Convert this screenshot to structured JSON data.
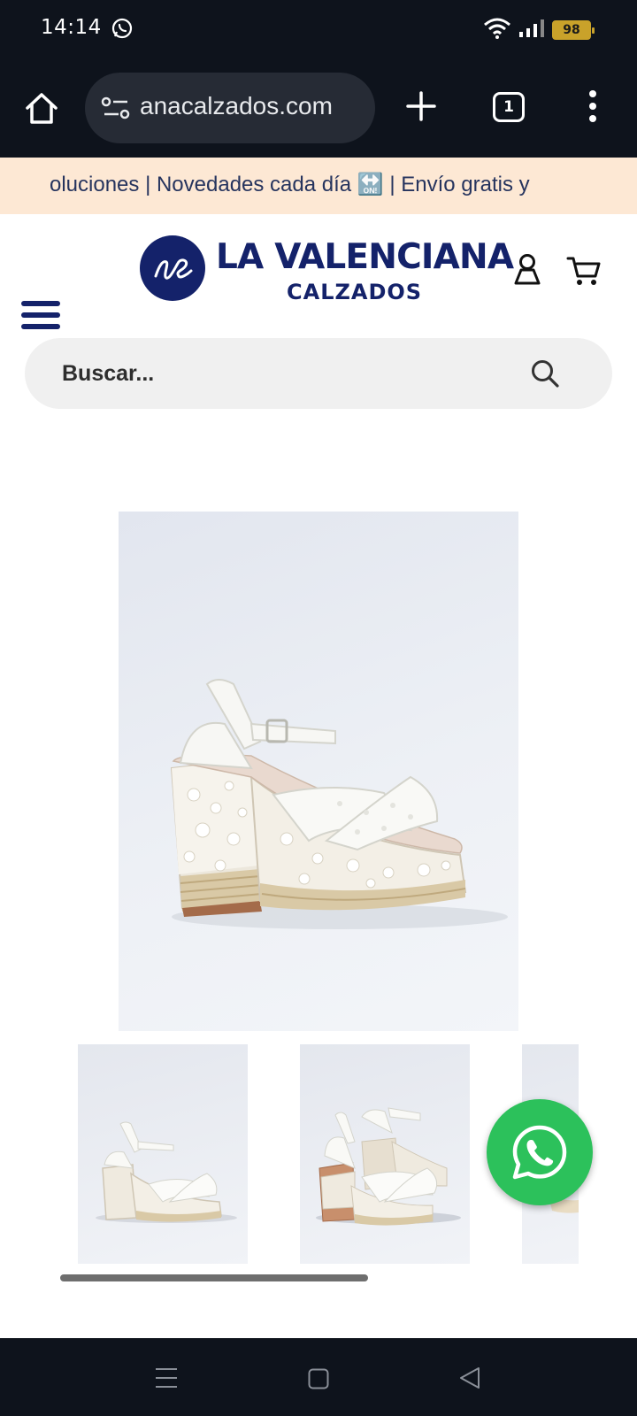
{
  "status_bar": {
    "time": "14:14",
    "battery": "98",
    "icons": [
      "whatsapp-icon",
      "wifi-icon",
      "signal-icon",
      "battery-icon"
    ]
  },
  "browser": {
    "url": "anacalzados.com",
    "tab_count": "1",
    "icons": [
      "home-icon",
      "site-settings-icon",
      "plus-icon",
      "tab-switcher-icon",
      "more-vert-icon"
    ]
  },
  "announcement": {
    "text": "oluciones | Novedades cada día 🔛 | Envío gratis y"
  },
  "header": {
    "brand_line1": "LA VALENCIANA",
    "brand_line2": "CALZADOS",
    "logo_monogram": "ve",
    "icons": [
      "user-icon",
      "cart-icon",
      "hamburger-menu-icon"
    ]
  },
  "search": {
    "placeholder": "Buscar...",
    "icon": "search-icon"
  },
  "product": {
    "main_image": "white-embroidered-platform-sandal",
    "thumbnails": [
      "sandal-side-view",
      "sandal-pair-front-view",
      "sandal-partial-view"
    ]
  },
  "whatsapp_button": {
    "icon": "whatsapp-icon"
  },
  "nav_bar": {
    "icons": [
      "menu-icon",
      "home-square-icon",
      "back-triangle-icon"
    ]
  },
  "colors": {
    "brand_navy": "#14226a",
    "announcement_bg": "#fde8d4",
    "whatsapp_green": "#2cc15b",
    "system_bar": "#0e131c"
  }
}
